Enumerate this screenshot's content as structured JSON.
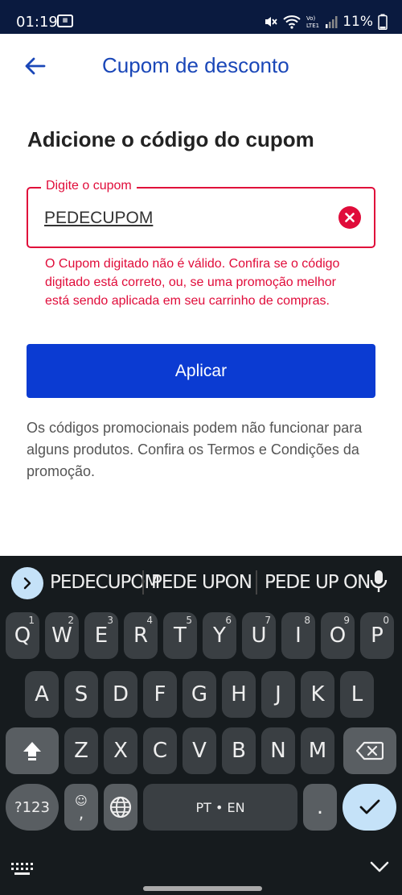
{
  "status_bar": {
    "time": "01:19",
    "notif_icon": "calendar-notification",
    "battery": "11%"
  },
  "app_bar": {
    "title": "Cupom de desconto",
    "back_icon": "arrow-left-icon"
  },
  "form": {
    "heading": "Adicione o código do cupom",
    "field_label": "Digite o cupom",
    "field_value": "PEDECUPOM",
    "error_message": "O Cupom digitado não é válido. Confira se o código digitado está correto, ou, se uma promoção melhor está sendo aplicada em seu carrinho de compras.",
    "apply_label": "Aplicar",
    "info_text": "Os códigos promocionais podem não funcionar para alguns produtos. Confira os Termos e Condições da promoção."
  },
  "colors": {
    "accent": "#0b3bd2",
    "title": "#1a47b8",
    "error": "#e00c3a",
    "status_bar": "#0a1a3f",
    "keyboard": "#161b1e"
  },
  "keyboard": {
    "suggestions": [
      "PEDECUPOM",
      "PEDE UPON",
      "PEDE UP ON"
    ],
    "row1": [
      {
        "k": "Q",
        "h": "1"
      },
      {
        "k": "W",
        "h": "2"
      },
      {
        "k": "E",
        "h": "3"
      },
      {
        "k": "R",
        "h": "4"
      },
      {
        "k": "T",
        "h": "5"
      },
      {
        "k": "Y",
        "h": "6"
      },
      {
        "k": "U",
        "h": "7"
      },
      {
        "k": "I",
        "h": "8"
      },
      {
        "k": "O",
        "h": "9"
      },
      {
        "k": "P",
        "h": "0"
      }
    ],
    "row2": [
      "A",
      "S",
      "D",
      "F",
      "G",
      "H",
      "J",
      "K",
      "L"
    ],
    "row3": [
      "Z",
      "X",
      "C",
      "V",
      "B",
      "N",
      "M"
    ],
    "symbols_label": "?123",
    "emoji_comma": ",",
    "space_label": "PT • EN",
    "period_label": "."
  }
}
